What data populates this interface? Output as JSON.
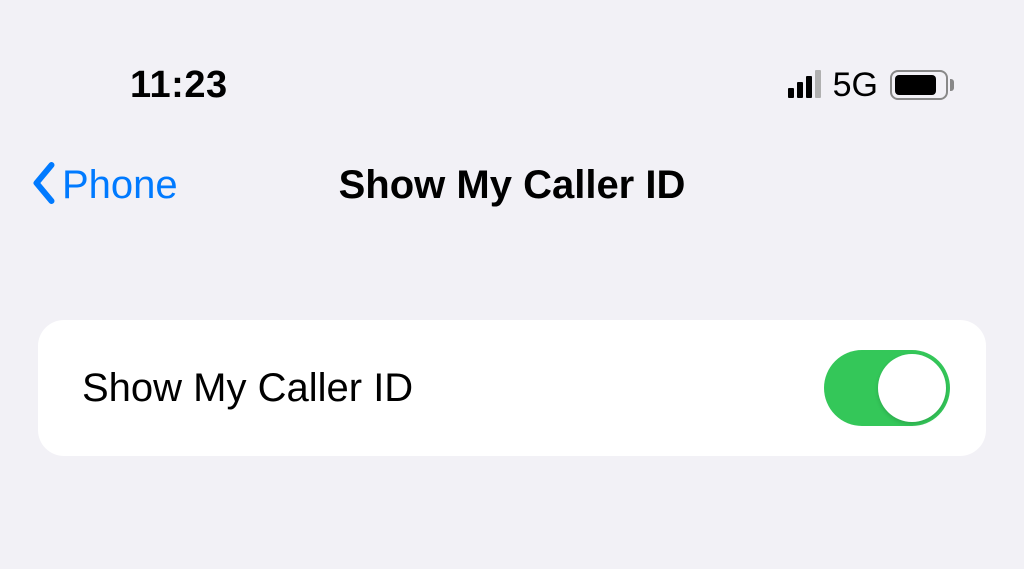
{
  "status": {
    "time": "11:23",
    "network": "5G"
  },
  "nav": {
    "back_label": "Phone",
    "title": "Show My Caller ID"
  },
  "settings": {
    "caller_id_label": "Show My Caller ID",
    "caller_id_on": true
  }
}
